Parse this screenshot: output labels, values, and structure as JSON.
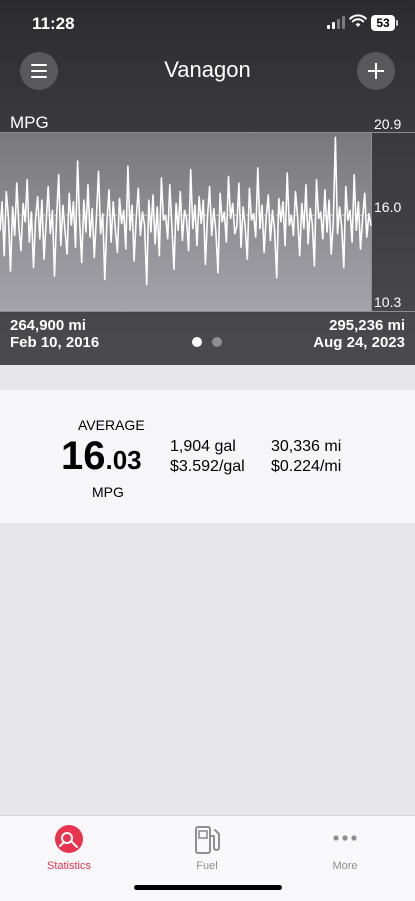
{
  "status_bar": {
    "time": "11:28",
    "battery": "53"
  },
  "nav": {
    "title": "Vanagon"
  },
  "chart_data": {
    "type": "bar",
    "title": "MPG",
    "y_ticks": [
      "20.9",
      "16.0",
      "10.3"
    ],
    "ylim": [
      10.3,
      20.9
    ],
    "average": 16.0,
    "x_start": {
      "odometer": "264,900 mi",
      "date": "Feb 10, 2016"
    },
    "x_end": {
      "odometer": "295,236 mi",
      "date": "Aug 24, 2023"
    },
    "series": [
      {
        "values": [
          15.1,
          16.8,
          13.6,
          17.4,
          15.9,
          12.7,
          16.5,
          14.8,
          17.9,
          15.3,
          13.9,
          16.7,
          15.6,
          18.1,
          14.4,
          16.2,
          12.9,
          15.8,
          17.1,
          14.6,
          16.9,
          13.4,
          15.5,
          17.7,
          14.9,
          16.3,
          12.4,
          15.9,
          18.4,
          14.2,
          16.6,
          15.1,
          13.7,
          17.3,
          15.4,
          16.8,
          14.1,
          19.2,
          15.7,
          13.2,
          16.9,
          15.0,
          17.8,
          14.7,
          16.4,
          13.5,
          15.9,
          18.6,
          14.9,
          16.1,
          12.2,
          15.6,
          17.5,
          14.4,
          16.8,
          15.2,
          13.8,
          17.0,
          15.5,
          16.3,
          14.0,
          18.9,
          15.1,
          16.6,
          13.3,
          15.8,
          17.6,
          14.8,
          16.2,
          15.4,
          11.9,
          16.9,
          15.0,
          17.2,
          14.3,
          16.5,
          13.6,
          18.2,
          15.7,
          16.0,
          14.6,
          17.8,
          15.3,
          12.8,
          16.7,
          15.1,
          17.4,
          14.5,
          16.3,
          15.8,
          13.9,
          18.7,
          15.2,
          16.6,
          14.2,
          17.1,
          15.5,
          16.9,
          13.1,
          15.9,
          17.7,
          14.8,
          16.4,
          15.0,
          12.6,
          17.3,
          15.6,
          16.2,
          14.4,
          18.3,
          15.8,
          16.7,
          14.9,
          15.4,
          17.9,
          14.1,
          16.5,
          15.3,
          13.4,
          17.6,
          15.7,
          16.1,
          14.7,
          18.8,
          15.2,
          16.6,
          13.8,
          15.9,
          17.2,
          14.5,
          16.3,
          15.1,
          12.3,
          17.0,
          15.6,
          16.8,
          14.2,
          18.5,
          15.4,
          16.0,
          14.8,
          17.4,
          15.9,
          13.6,
          16.7,
          15.2,
          17.8,
          14.3,
          16.4,
          15.5,
          13.0,
          18.1,
          15.8,
          16.2,
          14.6,
          17.5,
          15.0,
          16.9,
          13.7,
          15.6,
          20.6,
          14.9,
          16.5,
          15.3,
          12.9,
          17.7,
          15.7,
          16.3,
          14.4,
          18.4,
          15.1,
          16.8,
          14.0,
          15.8,
          17.3,
          14.7,
          16.1,
          15.4
        ]
      }
    ]
  },
  "carousel": {
    "pages": 2,
    "active": 0
  },
  "stats": {
    "average_label": "AVERAGE",
    "average_int": "16",
    "average_dec": ".03",
    "average_unit": "MPG",
    "gallons": "1,904 gal",
    "price_per_gal": "$3.592/gal",
    "distance": "30,336 mi",
    "cost_per_mile": "$0.224/mi"
  },
  "tabs": [
    {
      "label": "Statistics",
      "icon": "statistics-icon",
      "active": true
    },
    {
      "label": "Fuel",
      "icon": "fuel-pump-icon",
      "active": false
    },
    {
      "label": "More",
      "icon": "more-icon",
      "active": false
    }
  ],
  "colors": {
    "accent": "#e8344e",
    "inactive": "#8e8e93"
  }
}
